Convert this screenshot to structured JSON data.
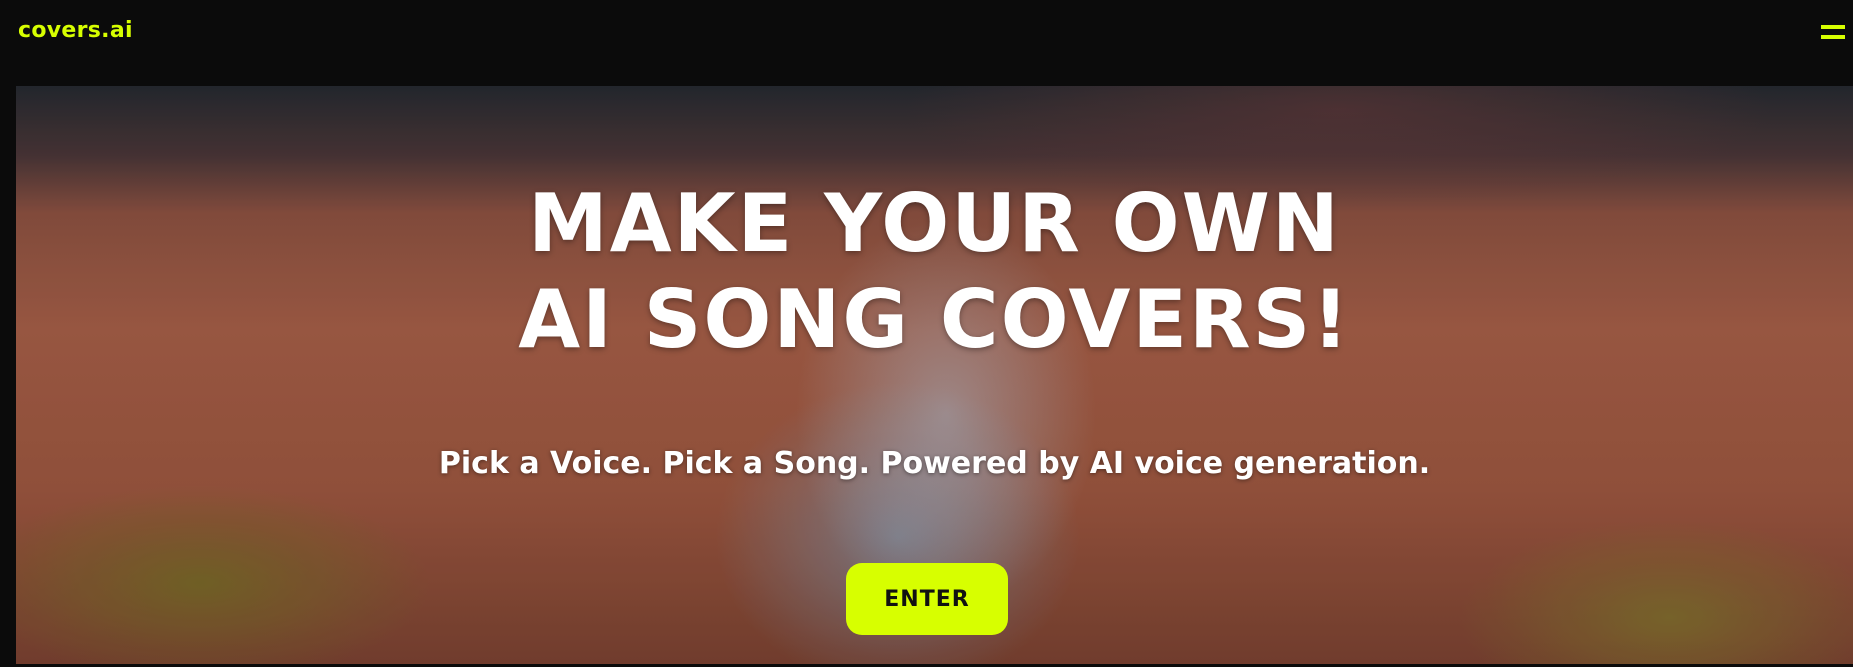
{
  "header": {
    "logo": "covers.ai",
    "menu_icon": "hamburger-icon"
  },
  "hero": {
    "headline": "MAKE YOUR OWN\nAI SONG COVERS!",
    "subtitle": "Pick a Voice. Pick a Song. Powered by AI voice generation.",
    "enter_label": "ENTER"
  },
  "colors": {
    "accent": "#d7ff00",
    "background": "#0b0b0b",
    "headline_text": "#ffffff"
  }
}
